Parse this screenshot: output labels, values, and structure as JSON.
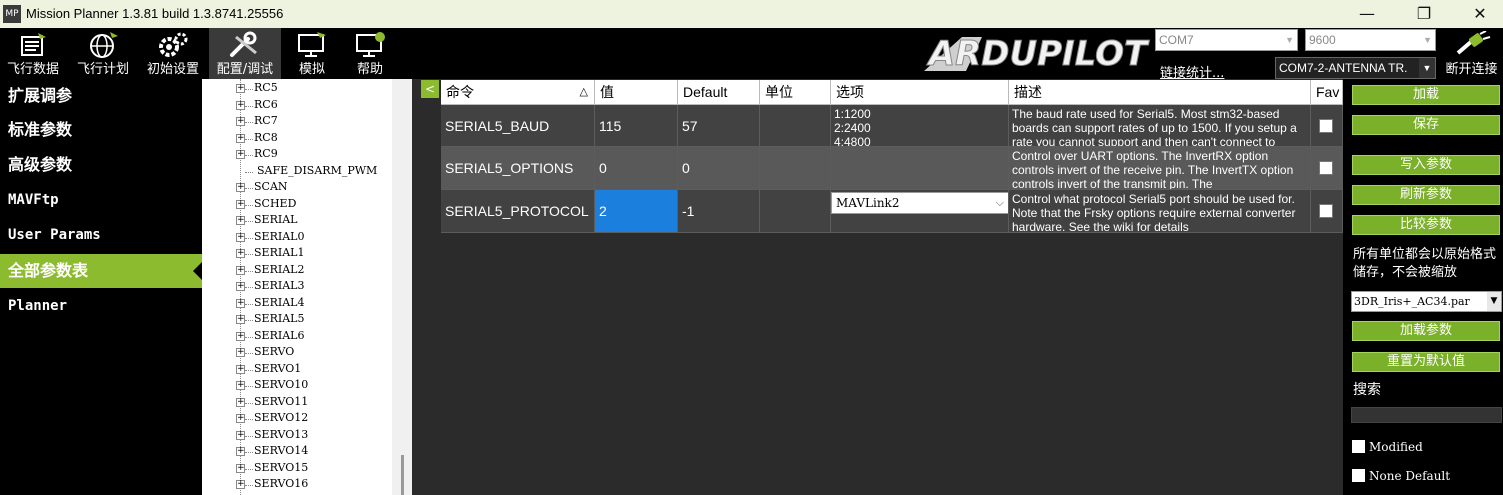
{
  "window": {
    "title": "Mission Planner 1.3.81 build 1.3.8741.25556",
    "app_icon_text": "MP",
    "minimize": "—",
    "maximize": "❐",
    "close": "✕"
  },
  "toolbar": {
    "buttons": [
      {
        "label": "飞行数据",
        "icon": "flight-data-icon"
      },
      {
        "label": "飞行计划",
        "icon": "flight-plan-globe-icon"
      },
      {
        "label": "初始设置",
        "icon": "initial-setup-gears-icon"
      },
      {
        "label": "配置/调试",
        "icon": "config-tuning-wrench-icon"
      },
      {
        "label": "模拟",
        "icon": "simulation-monitor-icon"
      },
      {
        "label": "帮助",
        "icon": "help-monitor-icon"
      }
    ],
    "logo_text": "ARDUPILOT",
    "port": "COM7",
    "baud": "9600",
    "link_stats": "链接统计...",
    "connection": "COM7-2-ANTENNA TR.",
    "disconnect": "断开连接"
  },
  "left_menu": {
    "items": [
      "扩展调参",
      "标准参数",
      "高级参数",
      "MAVFtp",
      "User Params",
      "全部参数表",
      "Planner"
    ],
    "active_index": 5
  },
  "tree": {
    "items": [
      {
        "label": "RC5",
        "expandable": true
      },
      {
        "label": "RC6",
        "expandable": true
      },
      {
        "label": "RC7",
        "expandable": true
      },
      {
        "label": "RC8",
        "expandable": true
      },
      {
        "label": "RC9",
        "expandable": true
      },
      {
        "label": "SAFE_DISARM_PWM",
        "expandable": false
      },
      {
        "label": "SCAN",
        "expandable": true
      },
      {
        "label": "SCHED",
        "expandable": true
      },
      {
        "label": "SERIAL",
        "expandable": true
      },
      {
        "label": "SERIAL0",
        "expandable": true
      },
      {
        "label": "SERIAL1",
        "expandable": true
      },
      {
        "label": "SERIAL2",
        "expandable": true
      },
      {
        "label": "SERIAL3",
        "expandable": true
      },
      {
        "label": "SERIAL4",
        "expandable": true
      },
      {
        "label": "SERIAL5",
        "expandable": true
      },
      {
        "label": "SERIAL6",
        "expandable": true
      },
      {
        "label": "SERVO",
        "expandable": true
      },
      {
        "label": "SERVO1",
        "expandable": true
      },
      {
        "label": "SERVO10",
        "expandable": true
      },
      {
        "label": "SERVO11",
        "expandable": true
      },
      {
        "label": "SERVO12",
        "expandable": true
      },
      {
        "label": "SERVO13",
        "expandable": true
      },
      {
        "label": "SERVO14",
        "expandable": true
      },
      {
        "label": "SERVO15",
        "expandable": true
      },
      {
        "label": "SERVO16",
        "expandable": true
      }
    ]
  },
  "collapse_button": "<",
  "grid": {
    "headers": {
      "command": "命令",
      "sort": "△",
      "value": "值",
      "default": "Default",
      "units": "单位",
      "options": "选项",
      "description": "描述",
      "fav": "Fav"
    },
    "rows": [
      {
        "command": "SERIAL5_BAUD",
        "value": "115",
        "default": "57",
        "units": "",
        "options": "1:1200\n2:2400\n4:4800",
        "description": "The baud rate used for Serial5. Most stm32-based boards can support rates of up to 1500. If you setup a rate you cannot support and then can't connect to",
        "fav": false
      },
      {
        "command": "SERIAL5_OPTIONS",
        "value": "0",
        "default": "0",
        "units": "",
        "options": "",
        "description": "Control over UART options. The InvertRX option controls invert of the receive pin. The InvertTX option controls invert of the transmit pin. The",
        "fav": false
      },
      {
        "command": "SERIAL5_PROTOCOL",
        "value": "2",
        "default": "-1",
        "units": "",
        "options": "MAVLink2",
        "description": "Control what protocol Serial5 port should be used for. Note that the Frsky options require external converter hardware. See the wiki for details",
        "fav": false
      }
    ],
    "selected_value_row": 2
  },
  "right_panel": {
    "buttons": [
      "加载",
      "保存",
      "写入参数",
      "刷新参数",
      "比较参数"
    ],
    "note": "所有单位都会以原始格式储存，不会被缩放",
    "param_file": "3DR_Iris+_AC34.par",
    "load_params": "加载参数",
    "reset_default": "重置为默认值",
    "search_label": "搜索",
    "modified": "Modified",
    "none_default": "None Default"
  },
  "colors": {
    "accent_green": "#8dbb2f",
    "button_green": "#7bb02a",
    "selection_blue": "#1a7fdd",
    "title_bar": "#eef3e0"
  }
}
